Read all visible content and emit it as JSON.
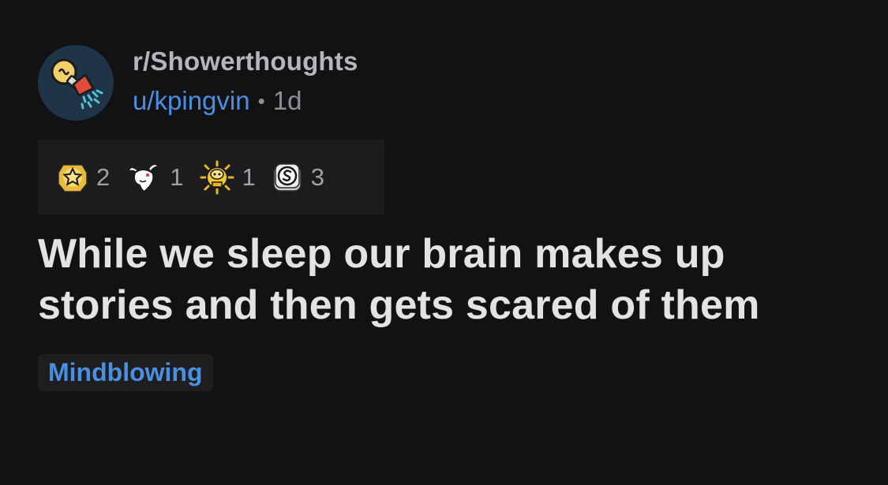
{
  "post": {
    "subreddit": "r/Showerthoughts",
    "username": "u/kpingvin",
    "separator": "•",
    "age": "1d",
    "title": "While we sleep our brain makes up stories and then gets scared of them",
    "flair": "Mindblowing",
    "avatar_icon": "lightbulb-showerhead-icon"
  },
  "awards": [
    {
      "name": "star-award-icon",
      "count": "2"
    },
    {
      "name": "goat-award-icon",
      "count": "1"
    },
    {
      "name": "gold-snoo-award-icon",
      "count": "1"
    },
    {
      "name": "silver-award-icon",
      "count": "3"
    }
  ],
  "colors": {
    "background": "#121214",
    "link_blue": "#4a90e2",
    "title_text": "#e3e3e5",
    "muted_text": "#8e8e93",
    "award_bar": "#1c1c1e"
  }
}
